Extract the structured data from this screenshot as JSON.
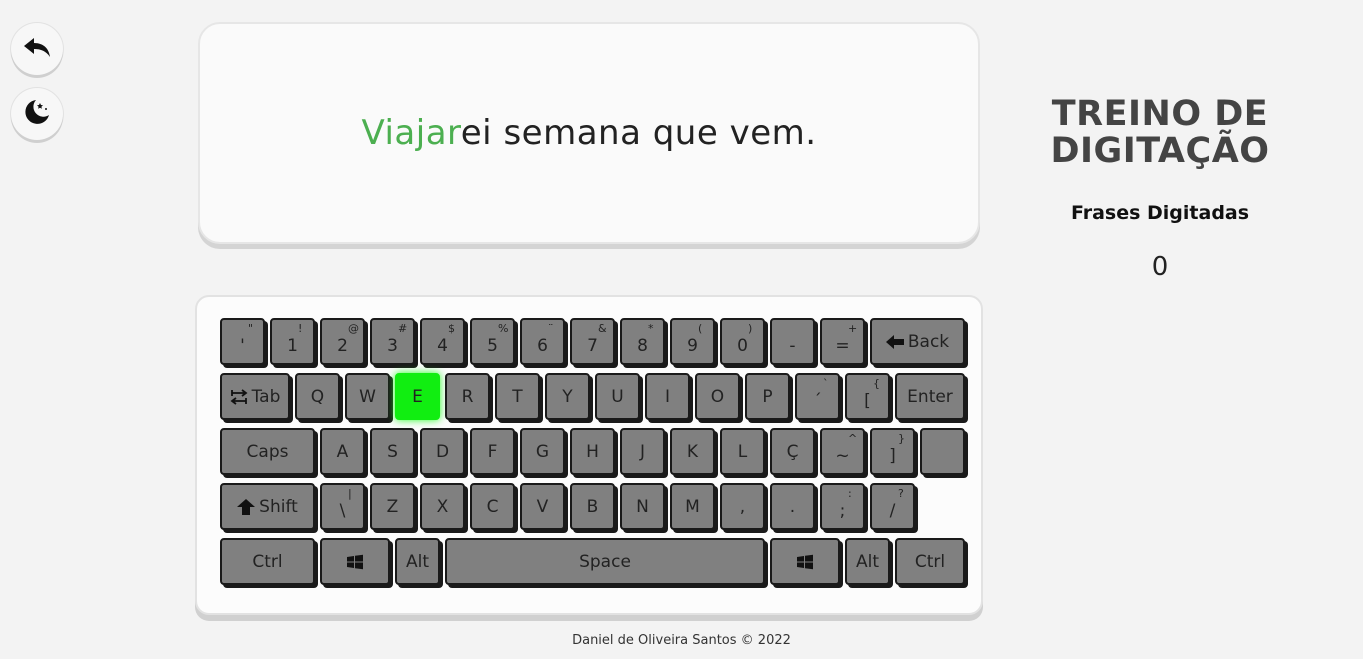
{
  "nav": {
    "back_icon": "undo-arrow-icon",
    "theme_icon": "moon-stars-icon"
  },
  "phrase": {
    "typed": "Viajar",
    "remaining": "ei semana que vem.",
    "typed_color": "#4caf50"
  },
  "panel": {
    "title_line1": "TREINO DE",
    "title_line2": "DIGITAÇÃO",
    "subtitle": "Frases Digitadas",
    "count": "0"
  },
  "keyboard": {
    "active_key": "E",
    "active_color": "#11ee11",
    "row1": [
      {
        "main": "'",
        "shift": "\""
      },
      {
        "main": "1",
        "shift": "!"
      },
      {
        "main": "2",
        "shift": "@"
      },
      {
        "main": "3",
        "shift": "#"
      },
      {
        "main": "4",
        "shift": "$"
      },
      {
        "main": "5",
        "shift": "%"
      },
      {
        "main": "6",
        "shift": "¨"
      },
      {
        "main": "7",
        "shift": "&"
      },
      {
        "main": "8",
        "shift": "*"
      },
      {
        "main": "9",
        "shift": "("
      },
      {
        "main": "0",
        "shift": ")"
      },
      {
        "main": "-",
        "shift": ""
      },
      {
        "main": "=",
        "shift": "+"
      }
    ],
    "backspace": "Back",
    "tab": "Tab",
    "row2": [
      "Q",
      "W",
      "E",
      "R",
      "T",
      "Y",
      "U",
      "I",
      "O",
      "P"
    ],
    "row2_extra": [
      {
        "main": "´",
        "shift": "`"
      },
      {
        "main": "[",
        "shift": "{"
      }
    ],
    "enter": "Enter",
    "caps": "Caps",
    "row3": [
      "A",
      "S",
      "D",
      "F",
      "G",
      "H",
      "J",
      "K",
      "L",
      "Ç"
    ],
    "row3_extra": [
      {
        "main": "~",
        "shift": "^"
      },
      {
        "main": "]",
        "shift": "}"
      }
    ],
    "shift": "Shift",
    "row4_first": {
      "main": "\\",
      "shift": "|"
    },
    "row4": [
      "Z",
      "X",
      "C",
      "V",
      "B",
      "N",
      "M",
      ",",
      "."
    ],
    "row4_extra": [
      {
        "main": ";",
        "shift": ":"
      },
      {
        "main": "/",
        "shift": "?"
      }
    ],
    "ctrl": "Ctrl",
    "alt": "Alt",
    "space": "Space",
    "win_icon": "windows-logo-icon"
  },
  "footer": {
    "text": "Daniel de Oliveira Santos © 2022"
  }
}
